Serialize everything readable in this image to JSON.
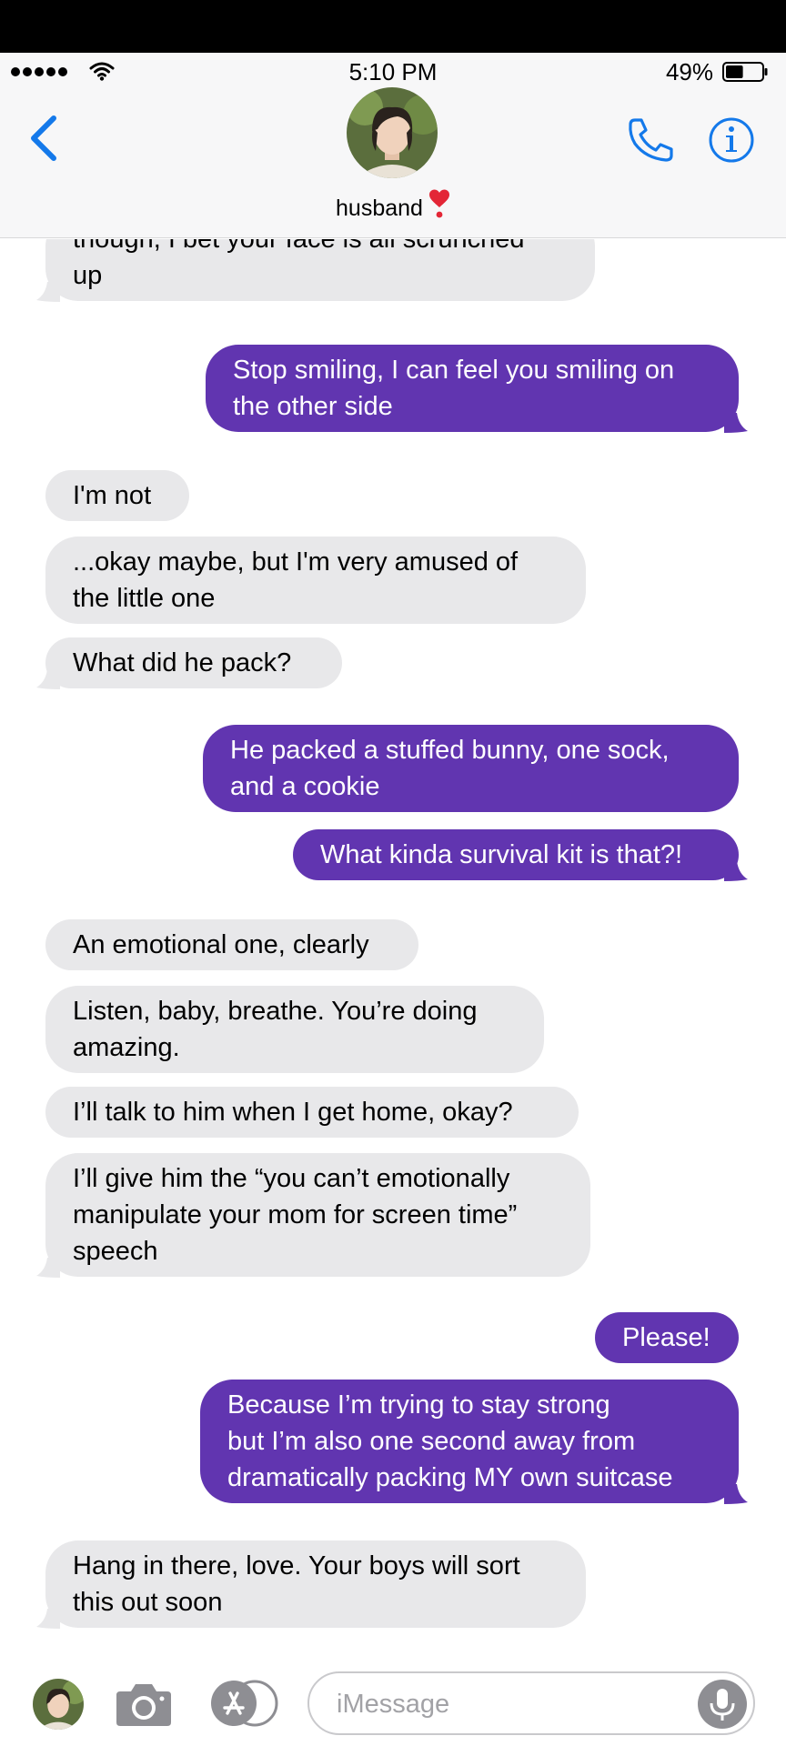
{
  "status_bar": {
    "time": "5:10 PM",
    "battery": "49%",
    "battery_level": 0.49
  },
  "header": {
    "contact_name": "husband",
    "contact_emoji": "heart-exclamation-icon"
  },
  "colors": {
    "accent": "#1479ea",
    "outgoing_bubble": "#6135b0",
    "incoming_bubble": "#e8e8ea"
  },
  "messages": [
    {
      "direction": "incoming",
      "lines": [
        "though, I bet your face is all scrunched",
        "up"
      ]
    },
    {
      "direction": "outgoing",
      "lines": [
        "Stop smiling, I can feel you smiling on",
        "the other side"
      ]
    },
    {
      "direction": "incoming",
      "lines": [
        "I'm not"
      ]
    },
    {
      "direction": "incoming",
      "lines": [
        "...okay maybe, but I'm very amused of",
        "the little one"
      ]
    },
    {
      "direction": "incoming",
      "lines": [
        "What did he pack?"
      ]
    },
    {
      "direction": "outgoing",
      "lines": [
        "He packed a stuffed bunny, one sock,",
        "and a cookie"
      ]
    },
    {
      "direction": "outgoing",
      "lines": [
        "What kinda survival kit is that?!"
      ]
    },
    {
      "direction": "incoming",
      "lines": [
        "An emotional one, clearly"
      ]
    },
    {
      "direction": "incoming",
      "lines": [
        "Listen, baby, breathe. You’re doing",
        "amazing."
      ]
    },
    {
      "direction": "incoming",
      "lines": [
        "I’ll talk to him when I get home, okay?"
      ]
    },
    {
      "direction": "incoming",
      "lines": [
        "I’ll give him the “you can’t emotionally",
        "manipulate your mom for screen time”",
        "speech"
      ]
    },
    {
      "direction": "outgoing",
      "lines": [
        "Please!"
      ]
    },
    {
      "direction": "outgoing",
      "lines": [
        "Because I’m trying to stay strong",
        "but I’m also one second away from",
        "dramatically packing MY own suitcase"
      ]
    },
    {
      "direction": "incoming",
      "lines": [
        "Hang in there, love. Your boys will sort",
        "this out soon"
      ]
    }
  ],
  "input": {
    "placeholder": "iMessage"
  }
}
